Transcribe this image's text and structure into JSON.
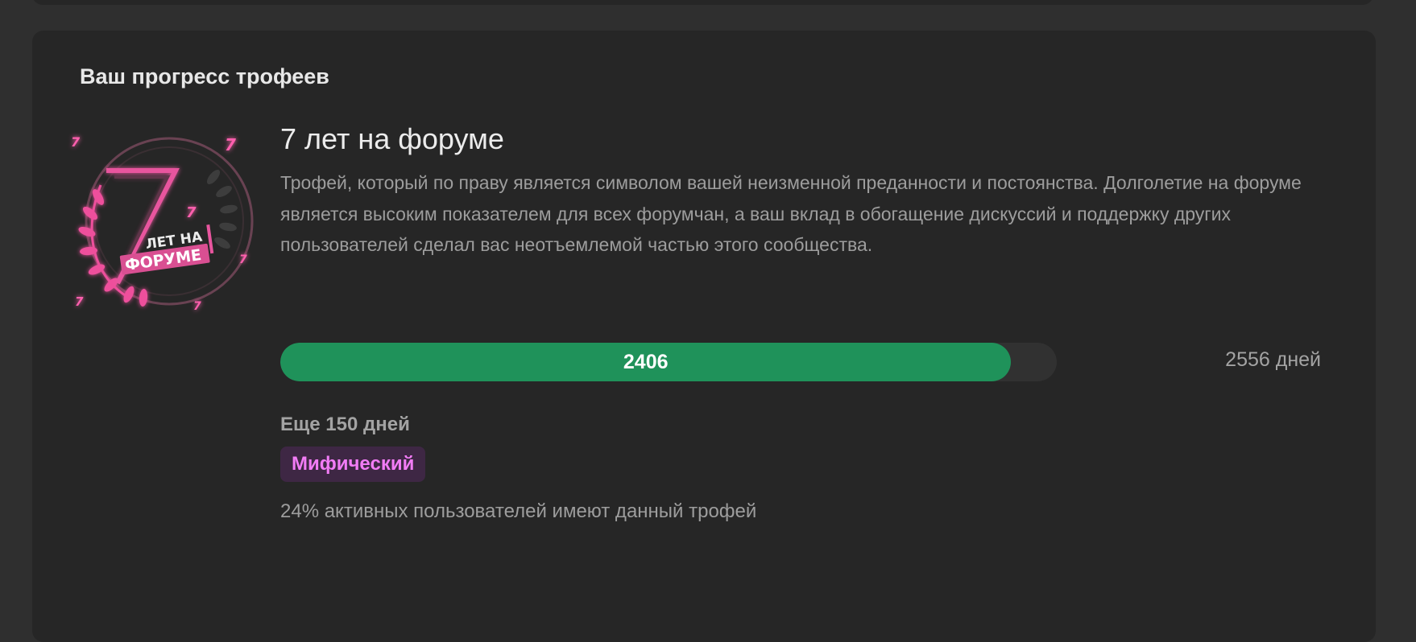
{
  "section": {
    "title": "Ваш прогресс трофеев"
  },
  "trophy": {
    "name": "7 лет на форуме",
    "description": "Трофей, который по праву является символом вашей неизменной преданности и постоянства. Долголетие на форуме является высоким показателем для всех форумчан, а ваш вклад в обогащение дискуссий и поддержку других пользователей сделал вас неотъемлемой частью этого сообщества.",
    "art": {
      "number": "7",
      "line1": "ЛЕТ НА",
      "line2": "ФОРУМЕ",
      "sparkle": "7"
    },
    "progress": {
      "current": 2406,
      "current_label": "2406",
      "target": 2556,
      "target_label": "2556 дней",
      "fill_color": "#1f925a"
    },
    "remaining_label": "Еще 150 дней",
    "rarity": {
      "label": "Мифический",
      "color": "#f27cf6"
    },
    "owners_label": "24% активных пользователей имеют данный трофей"
  }
}
